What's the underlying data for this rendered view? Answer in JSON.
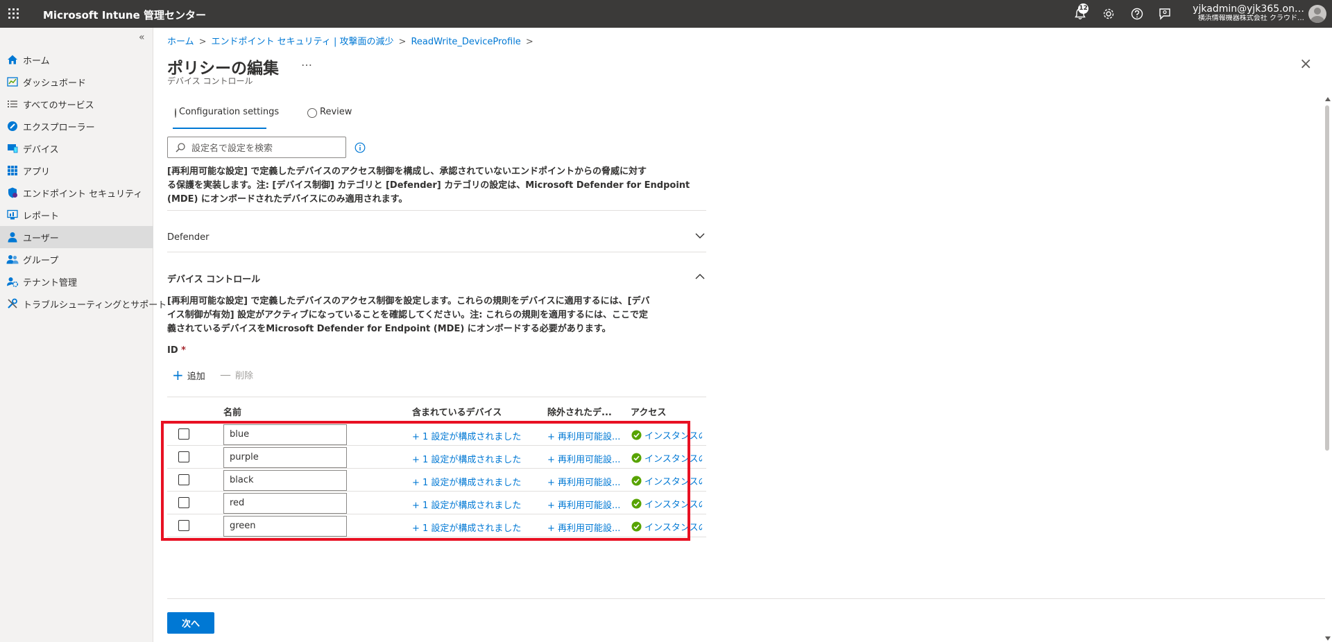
{
  "topbar": {
    "title": "Microsoft Intune 管理センター",
    "notification_count": "12",
    "user": "yjkadmin@yjk365.on…",
    "org": "横浜情報機器株式会社 クラウド…"
  },
  "sidebar": {
    "collapse_glyph": "«",
    "items": [
      {
        "label": "ホーム",
        "icon": "home-icon"
      },
      {
        "label": "ダッシュボード",
        "icon": "dashboard-icon"
      },
      {
        "label": "すべてのサービス",
        "icon": "list-icon"
      },
      {
        "label": "エクスプローラー",
        "icon": "explorer-icon"
      },
      {
        "label": "デバイス",
        "icon": "device-icon"
      },
      {
        "label": "アプリ",
        "icon": "apps-grid-icon"
      },
      {
        "label": "エンドポイント セキュリティ",
        "icon": "shield-icon"
      },
      {
        "label": "レポート",
        "icon": "report-icon"
      },
      {
        "label": "ユーザー",
        "icon": "user-icon"
      },
      {
        "label": "グループ",
        "icon": "group-icon"
      },
      {
        "label": "テナント管理",
        "icon": "tenant-gear-icon"
      },
      {
        "label": "トラブルシューティングとサポート",
        "icon": "wrench-icon"
      }
    ],
    "active_index": 8
  },
  "breadcrumb": [
    "ホーム",
    "エンドポイント セキュリティ | 攻撃面の減少",
    "ReadWrite_DeviceProfile"
  ],
  "page": {
    "title": "ポリシーの編集",
    "more": "…",
    "subtitle": "デバイス コントロール",
    "close": "×"
  },
  "tabs": [
    "Configuration settings",
    "Review"
  ],
  "search": {
    "placeholder": "設定名で設定を検索"
  },
  "intro_lines": [
    "[再利用可能な設定] で定義したデバイスのアクセス制御を構成し、承認されていないエンドポイントからの脅威に対す",
    "る保護を実装します。注: [デバイス制御] カテゴリと [Defender] カテゴリの設定は、Microsoft Defender for Endpoint",
    "(MDE) にオンボードされたデバイスにのみ適用されます。"
  ],
  "sections": {
    "defender": "Defender",
    "device_control": "デバイス コントロール"
  },
  "device_control_desc_lines": [
    "[再利用可能な設定] で定義したデバイスのアクセス制御を設定します。これらの規則をデバイスに適用するには、[デバ",
    "イス制御が有効] 設定がアクティブになっていることを確認してください。注: これらの規則を適用するには、ここで定",
    "義されているデバイスをMicrosoft Defender for Endpoint (MDE) にオンボードする必要があります。"
  ],
  "id_field": {
    "label": "ID",
    "required": "*"
  },
  "commands": {
    "add": "追加",
    "delete": "削除"
  },
  "table": {
    "headers": [
      "名前",
      "含まれているデバイス",
      "除外されたデ...",
      "アクセス"
    ],
    "rows": [
      {
        "name": "blue",
        "included": "+ 1 設定が構成されました",
        "excluded": "+ 再利用可能設...",
        "access": "インスタンスの"
      },
      {
        "name": "purple",
        "included": "+ 1 設定が構成されました",
        "excluded": "+ 再利用可能設...",
        "access": "インスタンスの"
      },
      {
        "name": "black",
        "included": "+ 1 設定が構成されました",
        "excluded": "+ 再利用可能設...",
        "access": "インスタンスの"
      },
      {
        "name": "red",
        "included": "+ 1 設定が構成されました",
        "excluded": "+ 再利用可能設...",
        "access": "インスタンスの"
      },
      {
        "name": "green",
        "included": "+ 1 設定が構成されました",
        "excluded": "+ 再利用可能設...",
        "access": "インスタンスの"
      }
    ]
  },
  "footer": {
    "next": "次へ"
  },
  "colors": {
    "accent": "#0078d4",
    "highlight": "#e81123",
    "success": "#57a300",
    "topbar": "#3b3a39"
  }
}
